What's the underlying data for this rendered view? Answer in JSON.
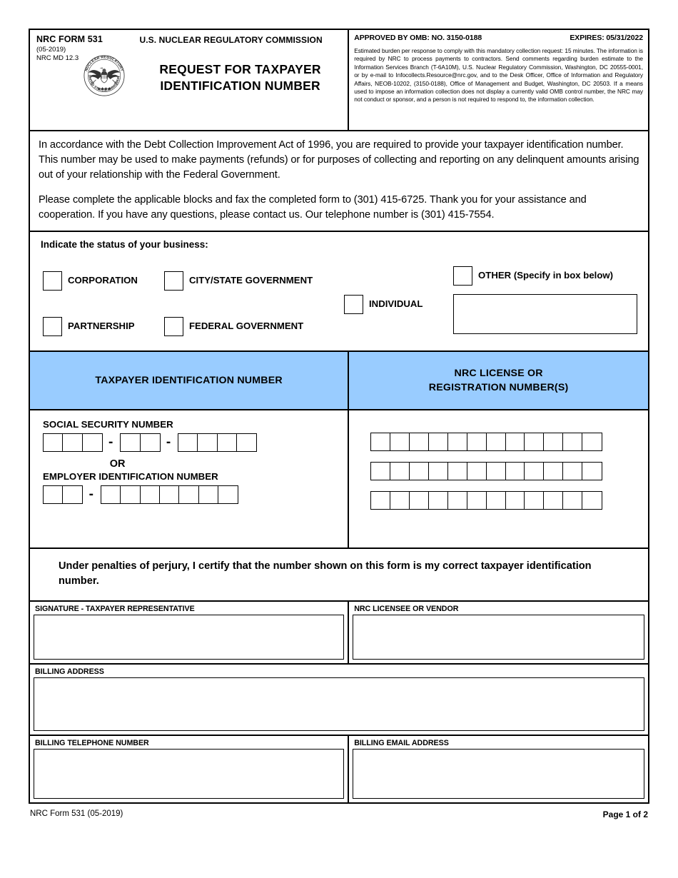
{
  "header": {
    "form_number": "NRC FORM 531",
    "revision": "(05-2019)",
    "md_number": "NRC MD 12.3",
    "agency": "U.S. NUCLEAR REGULATORY COMMISSION",
    "title_line1": "REQUEST FOR TAXPAYER",
    "title_line2": "IDENTIFICATION NUMBER",
    "seal_alt": "nrc-seal-icon",
    "omb_approved": "APPROVED BY OMB:  NO. 3150-0188",
    "omb_expires": "EXPIRES:  05/31/2022",
    "burden_statement": "Estimated burden per response to comply with this mandatory collection request: 15 minutes. The information is required by NRC to process payments to contractors. Send comments regarding burden estimate to the Information Services Branch (T-6A10M), U.S. Nuclear Regulatory Commission, Washington, DC 20555-0001, or by e-mail to Infocollects.Resource@nrc.gov, and to the Desk Officer, Office of Information and Regulatory Affairs, NEOB-10202, (3150-0188), Office of Management and Budget, Washington, DC 20503. If a means used to impose an information collection does not display a currently valid OMB control number, the NRC may not conduct or sponsor, and a person is not required to respond to, the information collection."
  },
  "instructions": {
    "paragraph1": "In accordance with the Debt Collection Improvement Act of 1996, you are required to provide your taxpayer identification number.  This number may be used to make payments (refunds) or for purposes of collecting and reporting on any delinquent amounts arising out of your relationship with the Federal Government.",
    "paragraph2": "Please complete the applicable blocks and fax the completed form to (301) 415-6725.  Thank you for your assistance and cooperation.  If you have any questions, please contact us.  Our telephone number is (301) 415-7554."
  },
  "status_section": {
    "label": "Indicate the status of your business:",
    "options": [
      {
        "label": "CORPORATION",
        "checked": false
      },
      {
        "label": "CITY/STATE GOVERNMENT",
        "checked": false
      },
      {
        "label": "PARTNERSHIP",
        "checked": false
      },
      {
        "label": "FEDERAL GOVERNMENT",
        "checked": false
      },
      {
        "label": "INDIVIDUAL",
        "checked": false
      },
      {
        "label": "OTHER",
        "checked": false
      }
    ],
    "other_hint": "(Specify in box below)",
    "other_specify_value": ""
  },
  "bands": {
    "taxpayer": "TAXPAYER IDENTIFICATION NUMBER",
    "license_line1": "NRC LICENSE OR",
    "license_line2": "REGISTRATION NUMBER(S)"
  },
  "tin": {
    "ssn_label": "SOCIAL SECURITY NUMBER",
    "or_label": "OR",
    "ein_label": "EMPLOYER IDENTIFICATION NUMBER",
    "dash": "-",
    "ssn_groups": [
      3,
      2,
      4
    ],
    "ein_groups": [
      2,
      7
    ],
    "license_rows": [
      12,
      12,
      12
    ],
    "ssn_value": "",
    "ein_value": "",
    "license_values": [
      "",
      "",
      ""
    ]
  },
  "certification": {
    "text": "Under penalties of perjury, I certify that the number shown on this form is my correct taxpayer identification number."
  },
  "fields": {
    "signature_label": "SIGNATURE - TAXPAYER REPRESENTATIVE",
    "signature_value": "",
    "vendor_label": "NRC LICENSEE OR VENDOR",
    "vendor_value": "",
    "billing_address_label": "BILLING ADDRESS",
    "billing_address_value": "",
    "billing_phone_label": "BILLING TELEPHONE NUMBER",
    "billing_phone_value": "",
    "billing_email_label": "BILLING EMAIL ADDRESS",
    "billing_email_value": ""
  },
  "footer": {
    "left": "NRC Form 531 (05-2019)",
    "right": "Page 1 of 2"
  },
  "colors": {
    "band_blue": "#99ccff",
    "border": "#000000",
    "page": "#ffffff"
  }
}
